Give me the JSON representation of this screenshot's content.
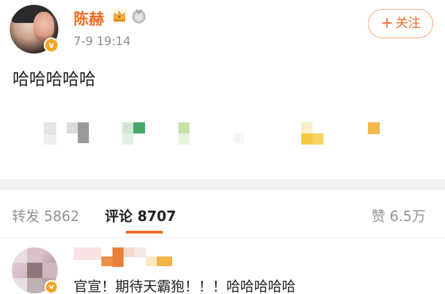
{
  "post": {
    "author": "陈赫",
    "time": "7-9 19:14",
    "text": "哈哈哈哈哈",
    "follow_label": "关注",
    "follow_icon": "plus-icon"
  },
  "badges": {
    "crown_color": "#f5b33a",
    "medal_color": "#b9b9b9",
    "verify_color": "#f4a623"
  },
  "tabs": {
    "repost_label": "转发",
    "repost_count": "5862",
    "comment_label": "评论",
    "comment_count": "8707",
    "like_label": "赞",
    "like_count": "6.5万"
  },
  "comment": {
    "text": "官宣！期待天霸狍！！！哈哈哈哈哈"
  },
  "colors": {
    "accent": "#f06b22",
    "muted": "#8c8c8c"
  }
}
